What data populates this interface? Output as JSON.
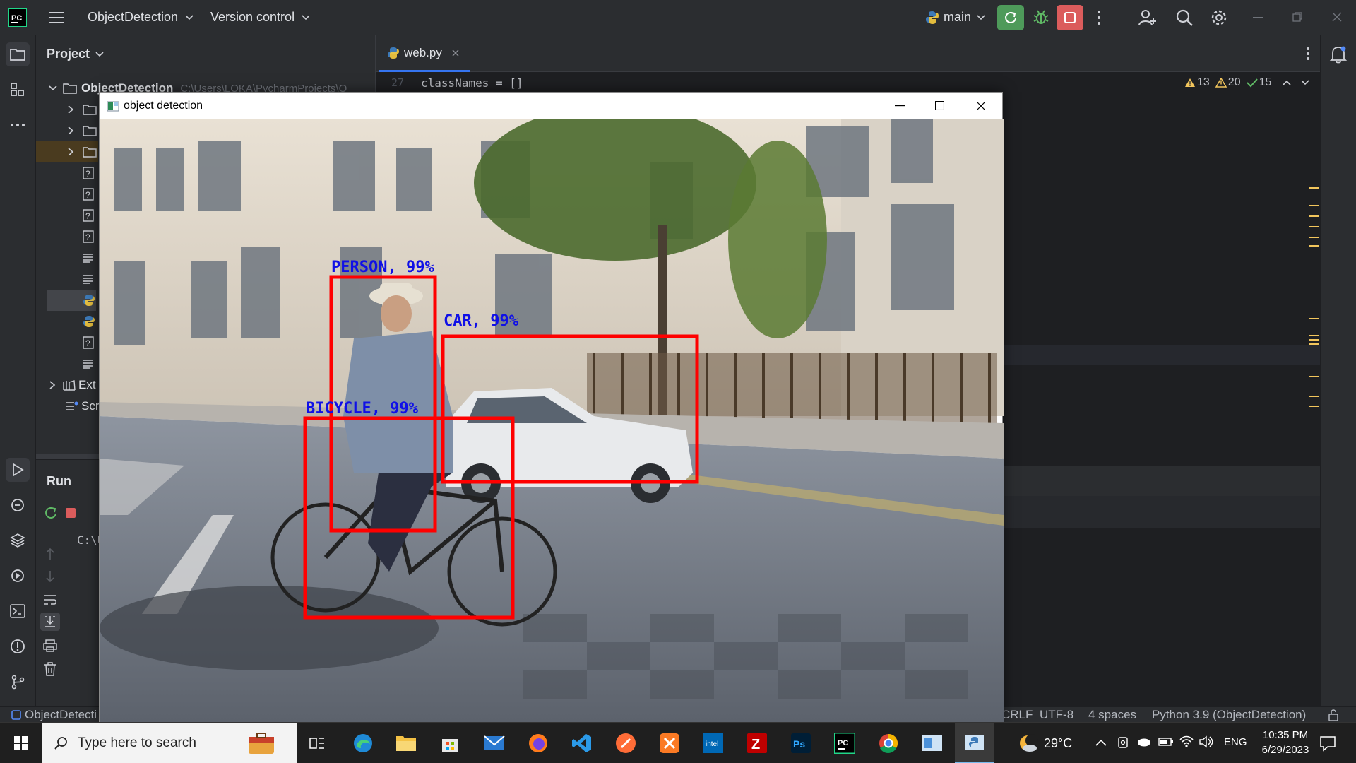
{
  "titlebar": {
    "project_name": "ObjectDetection",
    "vcs_label": "Version control",
    "branch": "main"
  },
  "project_panel": {
    "title": "Project",
    "root_name": "ObjectDetection",
    "root_path": "C:\\Users\\LOKA\\PycharmProjects\\O",
    "ext_label": "Ext",
    "scratch_label": "Scr"
  },
  "run_panel": {
    "title": "Run",
    "console_text": "C:\\U"
  },
  "editor": {
    "tab_name": "web.py",
    "line_number": "27",
    "code_line": "classNames = []",
    "inspections": {
      "warnings": "13",
      "weak_warnings": "20",
      "ok": "15"
    }
  },
  "popup": {
    "title": "object detection",
    "detections": [
      {
        "label": "PERSON, 99%"
      },
      {
        "label": "CAR, 99%"
      },
      {
        "label": "BICYCLE, 99%"
      }
    ]
  },
  "statusbar": {
    "breadcrumb": "ObjectDetecti",
    "line_sep": "CRLF",
    "encoding": "UTF-8",
    "indent": "4 spaces",
    "interpreter": "Python 3.9 (ObjectDetection)"
  },
  "taskbar": {
    "search_placeholder": "Type here to search",
    "weather": "29°C",
    "language": "ENG",
    "time": "10:35 PM",
    "date": "6/29/2023"
  },
  "colors": {
    "ide_bg": "#1e1f22",
    "panel_bg": "#2b2d30",
    "bbox_red": "#ff0000",
    "label_blue": "#1010e6",
    "run_green": "#4e9a5a",
    "stop_red": "#db5c5c"
  }
}
